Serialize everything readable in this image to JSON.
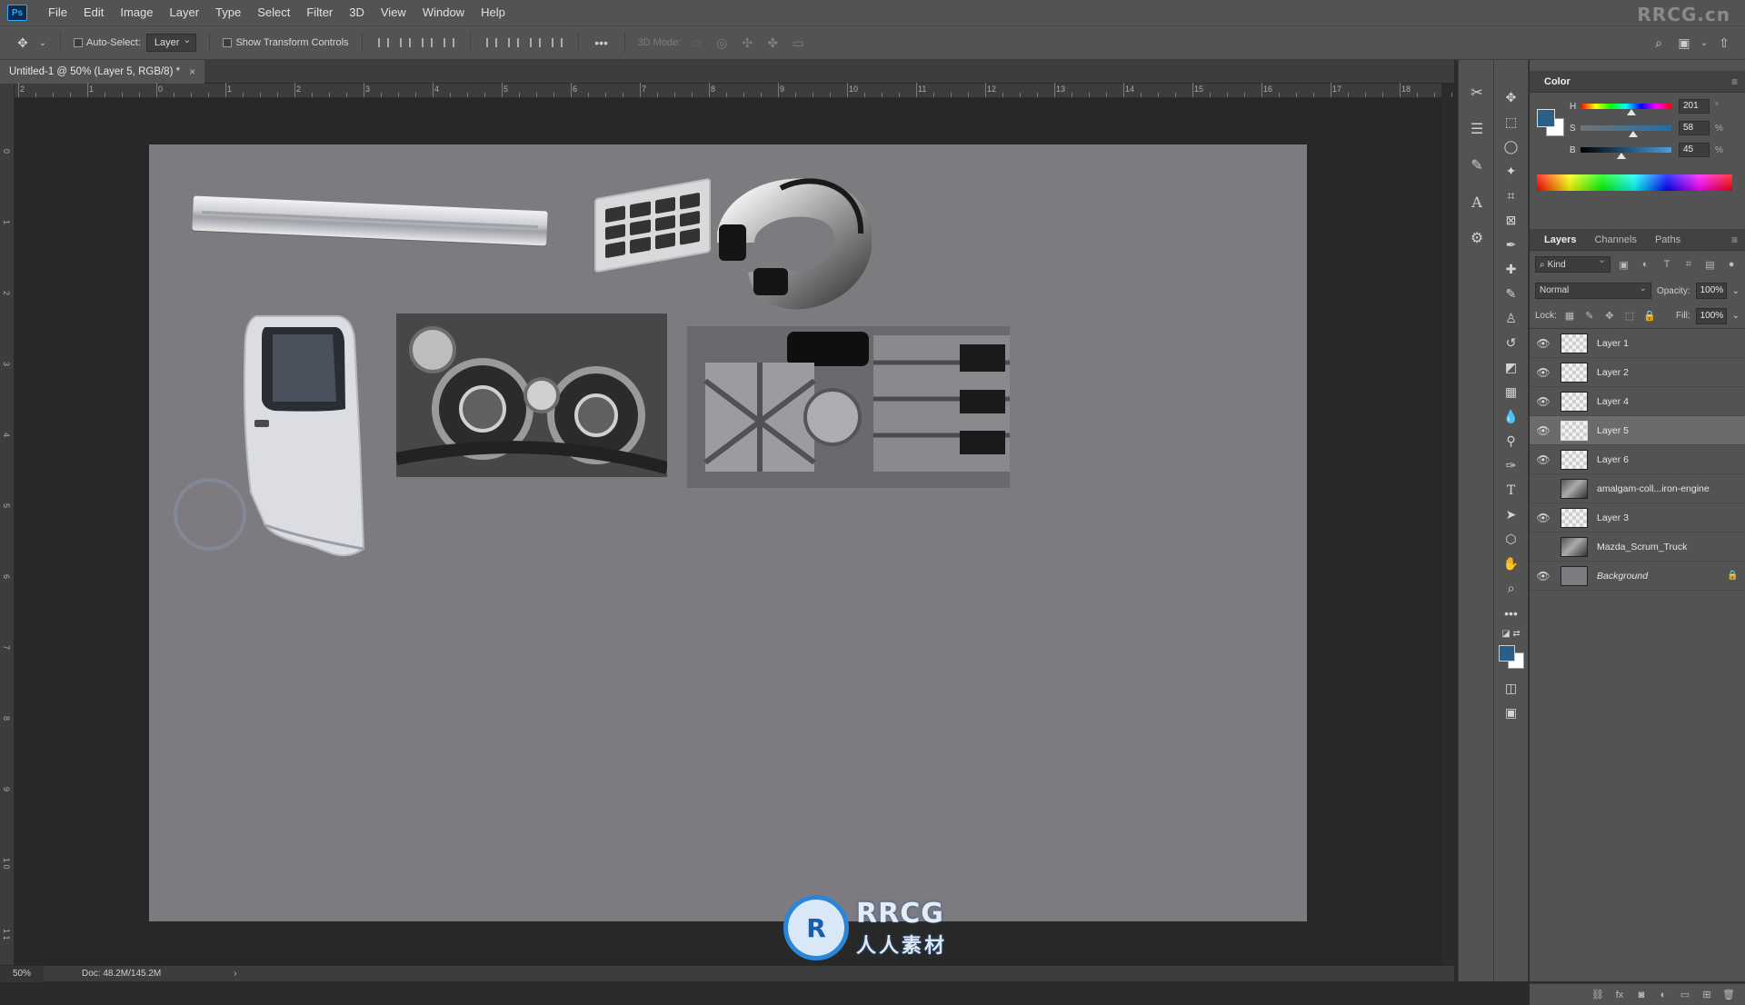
{
  "app": {
    "logo": "Ps",
    "watermark_top": "RRCG.cn"
  },
  "menu": [
    "File",
    "Edit",
    "Image",
    "Layer",
    "Type",
    "Select",
    "Filter",
    "3D",
    "View",
    "Window",
    "Help"
  ],
  "options_bar": {
    "auto_select_label": "Auto-Select:",
    "auto_select_target": "Layer",
    "show_transform_label": "Show Transform Controls",
    "mode_3d_label": "3D Mode:",
    "more_icon": "more-horizontal-icon"
  },
  "document": {
    "tab_title": "Untitled-1 @ 50% (Layer 5, RGB/8) *",
    "close_glyph": "×"
  },
  "rulers": {
    "top": [
      "2",
      "1",
      "0",
      "1",
      "2",
      "3",
      "4",
      "5",
      "6",
      "7",
      "8",
      "9",
      "10",
      "11",
      "12",
      "13",
      "14",
      "15",
      "16",
      "17",
      "18"
    ],
    "left": [
      "0",
      "1",
      "2",
      "3",
      "4",
      "5",
      "6",
      "7",
      "8",
      "9",
      "1 0",
      "1 1"
    ]
  },
  "status": {
    "zoom": "50%",
    "doc_size": "Doc: 48.2M/145.2M",
    "arrow": "›"
  },
  "watermark": {
    "logo_letters": "R",
    "text_en": "RRCG",
    "text_cn": "人人素材"
  },
  "color_panel": {
    "tab": "Color",
    "foreground": "#2c5f86",
    "background": "#ffffff",
    "h": {
      "label": "H",
      "value": "201",
      "unit": "°",
      "level": 0.56
    },
    "s": {
      "label": "S",
      "value": "58",
      "unit": "%",
      "level": 0.58
    },
    "b": {
      "label": "B",
      "value": "45",
      "unit": "%",
      "level": 0.45
    }
  },
  "layers_panel": {
    "tabs": [
      "Layers",
      "Channels",
      "Paths"
    ],
    "kind_label": "Kind",
    "blend_mode": "Normal",
    "opacity_label": "Opacity:",
    "opacity_value": "100%",
    "lock_label": "Lock:",
    "fill_label": "Fill:",
    "fill_value": "100%",
    "layers": [
      {
        "name": "Layer 1",
        "visible": true,
        "selected": false,
        "thumb": "transparent"
      },
      {
        "name": "Layer 2",
        "visible": true,
        "selected": false,
        "thumb": "transparent"
      },
      {
        "name": "Layer 4",
        "visible": true,
        "selected": false,
        "thumb": "transparent"
      },
      {
        "name": "Layer 5",
        "visible": true,
        "selected": true,
        "thumb": "transparent"
      },
      {
        "name": "Layer 6",
        "visible": true,
        "selected": false,
        "thumb": "transparent"
      },
      {
        "name": "amalgam-coll...iron-engine",
        "visible": false,
        "selected": false,
        "thumb": "photo"
      },
      {
        "name": "Layer 3",
        "visible": true,
        "selected": false,
        "thumb": "transparent"
      },
      {
        "name": "Mazda_Scrum_Truck",
        "visible": false,
        "selected": false,
        "thumb": "photo"
      },
      {
        "name": "Background",
        "visible": true,
        "selected": false,
        "thumb": "fill",
        "italic": true,
        "locked": true
      }
    ]
  }
}
